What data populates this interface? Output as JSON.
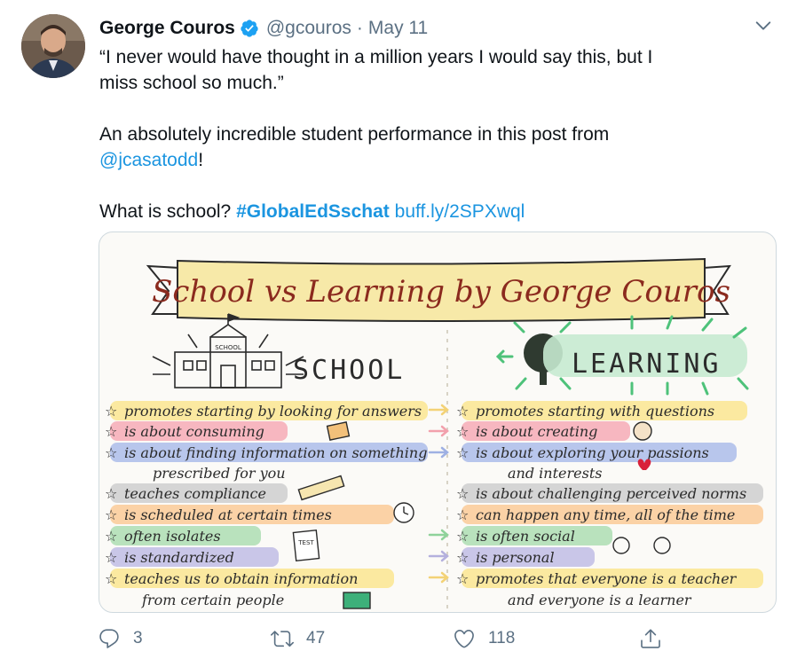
{
  "tweet": {
    "author_name": "George Couros",
    "handle": "@gcouros",
    "separator": "·",
    "date": "May 11",
    "text_line1": "“I never would have thought in a million years I would say this, but I",
    "text_line2": "miss school so much.”",
    "text_line3": "An absolutely incredible student performance in this post from",
    "mention": "@jcasatodd",
    "mention_suffix": "!",
    "text_line5_prefix": "What is school?",
    "hashtag": "#GlobalEdSschat",
    "short_link": "buff.ly/2SPXwql"
  },
  "image": {
    "banner_title": "School vs Learning by George Couros",
    "school_heading": "SCHOOL",
    "school_sign": "SCHOOL",
    "learning_heading": "LEARNING",
    "test_label": "TEST",
    "school_items": [
      "promotes starting by looking for answers",
      "is about consuming",
      "is about finding information on something",
      "prescribed for you",
      "teaches compliance",
      "is scheduled at certain times",
      "often isolates",
      "is standardized",
      "teaches us to obtain information",
      "from certain people"
    ],
    "learning_items": [
      "promotes starting with questions",
      "is about creating",
      "is about exploring your passions",
      "and interests",
      "is about challenging perceived norms",
      "can happen any time, all of the time",
      "is often social",
      "is personal",
      "promotes that everyone is a teacher",
      "and everyone is a learner"
    ],
    "colors": {
      "banner": "#f7e9a8",
      "yellow_highlight": "#fbe9a0",
      "pink_highlight": "#f7b7c0",
      "blue_highlight": "#b8c6ec",
      "green_highlight": "#b9e2bd",
      "purple_highlight": "#c9c6e8",
      "orange_highlight": "#fbd2a6",
      "ink": "#2b2b2b",
      "banner_ink": "#8b2a1e",
      "green_arrow": "#4ec27a"
    }
  },
  "actions": {
    "reply_count": "3",
    "retweet_count": "47",
    "like_count": "118"
  },
  "icons": {
    "verified": "verified-badge-icon",
    "caret": "chevron-down-icon",
    "reply": "reply-icon",
    "retweet": "retweet-icon",
    "like": "heart-icon",
    "share": "share-icon"
  },
  "accent_color": "#1b95e0"
}
